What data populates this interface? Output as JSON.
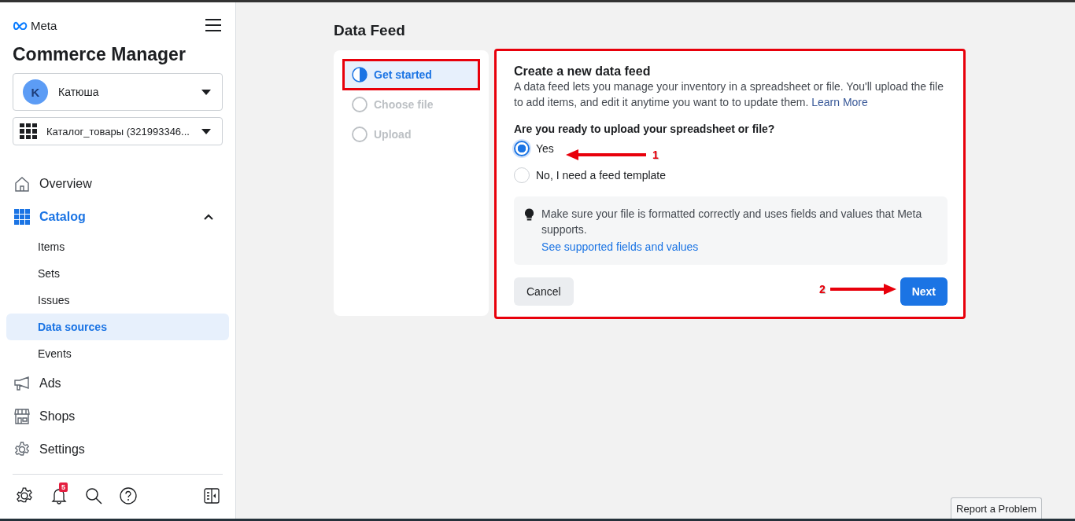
{
  "sidebar": {
    "brand": "Meta",
    "app_title": "Commerce Manager",
    "account": {
      "initial": "K",
      "name": "Катюша"
    },
    "catalog_select": "Каталог_товары (321993346...",
    "nav": [
      {
        "label": "Overview",
        "selected": false
      },
      {
        "label": "Catalog",
        "selected": true,
        "expanded": true,
        "children": [
          {
            "label": "Items",
            "selected": false
          },
          {
            "label": "Sets",
            "selected": false
          },
          {
            "label": "Issues",
            "selected": false
          },
          {
            "label": "Data sources",
            "selected": true
          },
          {
            "label": "Events",
            "selected": false
          }
        ]
      },
      {
        "label": "Ads",
        "selected": false
      },
      {
        "label": "Shops",
        "selected": false
      },
      {
        "label": "Settings",
        "selected": false
      }
    ],
    "notification_count": "5"
  },
  "page_title": "Data Feed",
  "steps": [
    {
      "label": "Get started",
      "selected": true,
      "highlighted": true
    },
    {
      "label": "Choose file",
      "selected": false,
      "highlighted": false
    },
    {
      "label": "Upload",
      "selected": false,
      "highlighted": false
    }
  ],
  "card": {
    "highlighted": true,
    "title": "Create a new data feed",
    "description": "A data feed lets you manage your inventory in a spreadsheet or file. You'll upload the file to add items, and edit it anytime you want to to update them.",
    "learn_more": "Learn More",
    "question": "Are you ready to upload your spreadsheet or file?",
    "options": [
      {
        "label": "Yes",
        "selected": true
      },
      {
        "label": "No, I need a feed template",
        "selected": false
      }
    ],
    "tip": {
      "text": "Make sure your file is formatted correctly and uses fields and values that Meta supports.",
      "link": "See supported fields and values"
    },
    "cancel": "Cancel",
    "next": "Next"
  },
  "annotations": [
    {
      "label": "1"
    },
    {
      "label": "2"
    }
  ],
  "report_button": "Report a Problem"
}
